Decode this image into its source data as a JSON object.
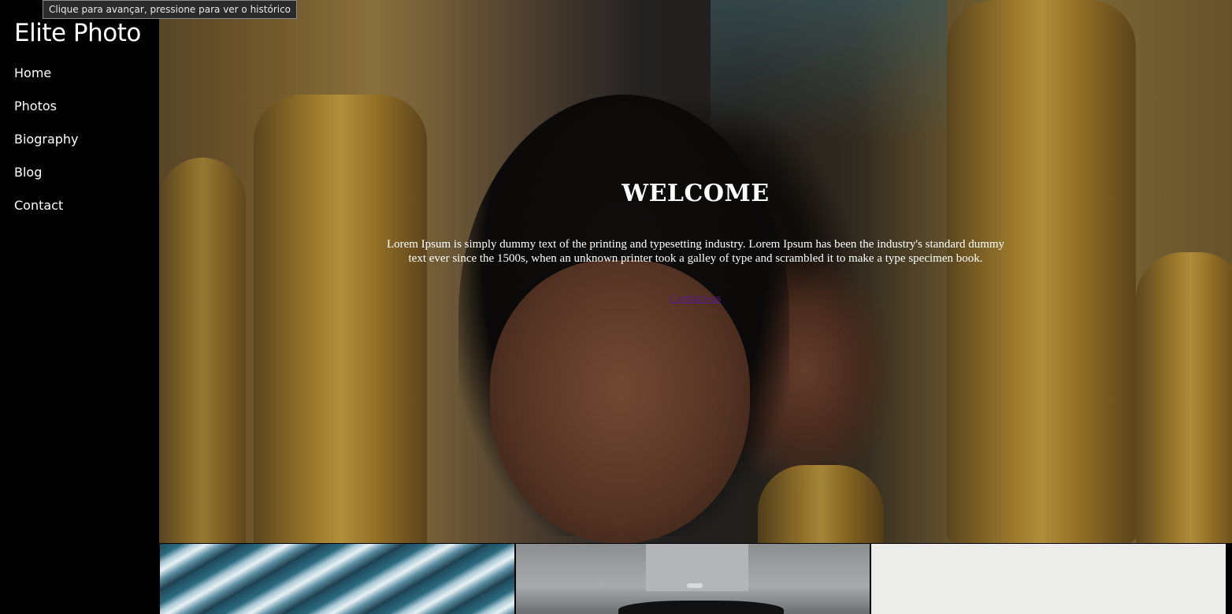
{
  "tooltip": {
    "text": "Clique para avançar, pressione para ver o histórico"
  },
  "sidebar": {
    "brand": "Elite Photo",
    "items": [
      {
        "label": "Home"
      },
      {
        "label": "Photos"
      },
      {
        "label": "Biography"
      },
      {
        "label": "Blog"
      },
      {
        "label": "Contact"
      }
    ]
  },
  "hero": {
    "title": "WELCOME",
    "description": "Lorem Ipsum is simply dummy text of the printing and typesetting industry. Lorem Ipsum has been the industry's standard dummy text ever since the 1500s, when an unknown printer took a galley of type and scrambled it to make a type specimen book.",
    "link_label": "Contact-us",
    "link_color": "#551a8b"
  },
  "gallery": {
    "thumbnails": [
      {
        "subject": "blue ice abstract"
      },
      {
        "subject": "person in grey cardigan"
      },
      {
        "subject": "light grey backdrop"
      }
    ]
  }
}
